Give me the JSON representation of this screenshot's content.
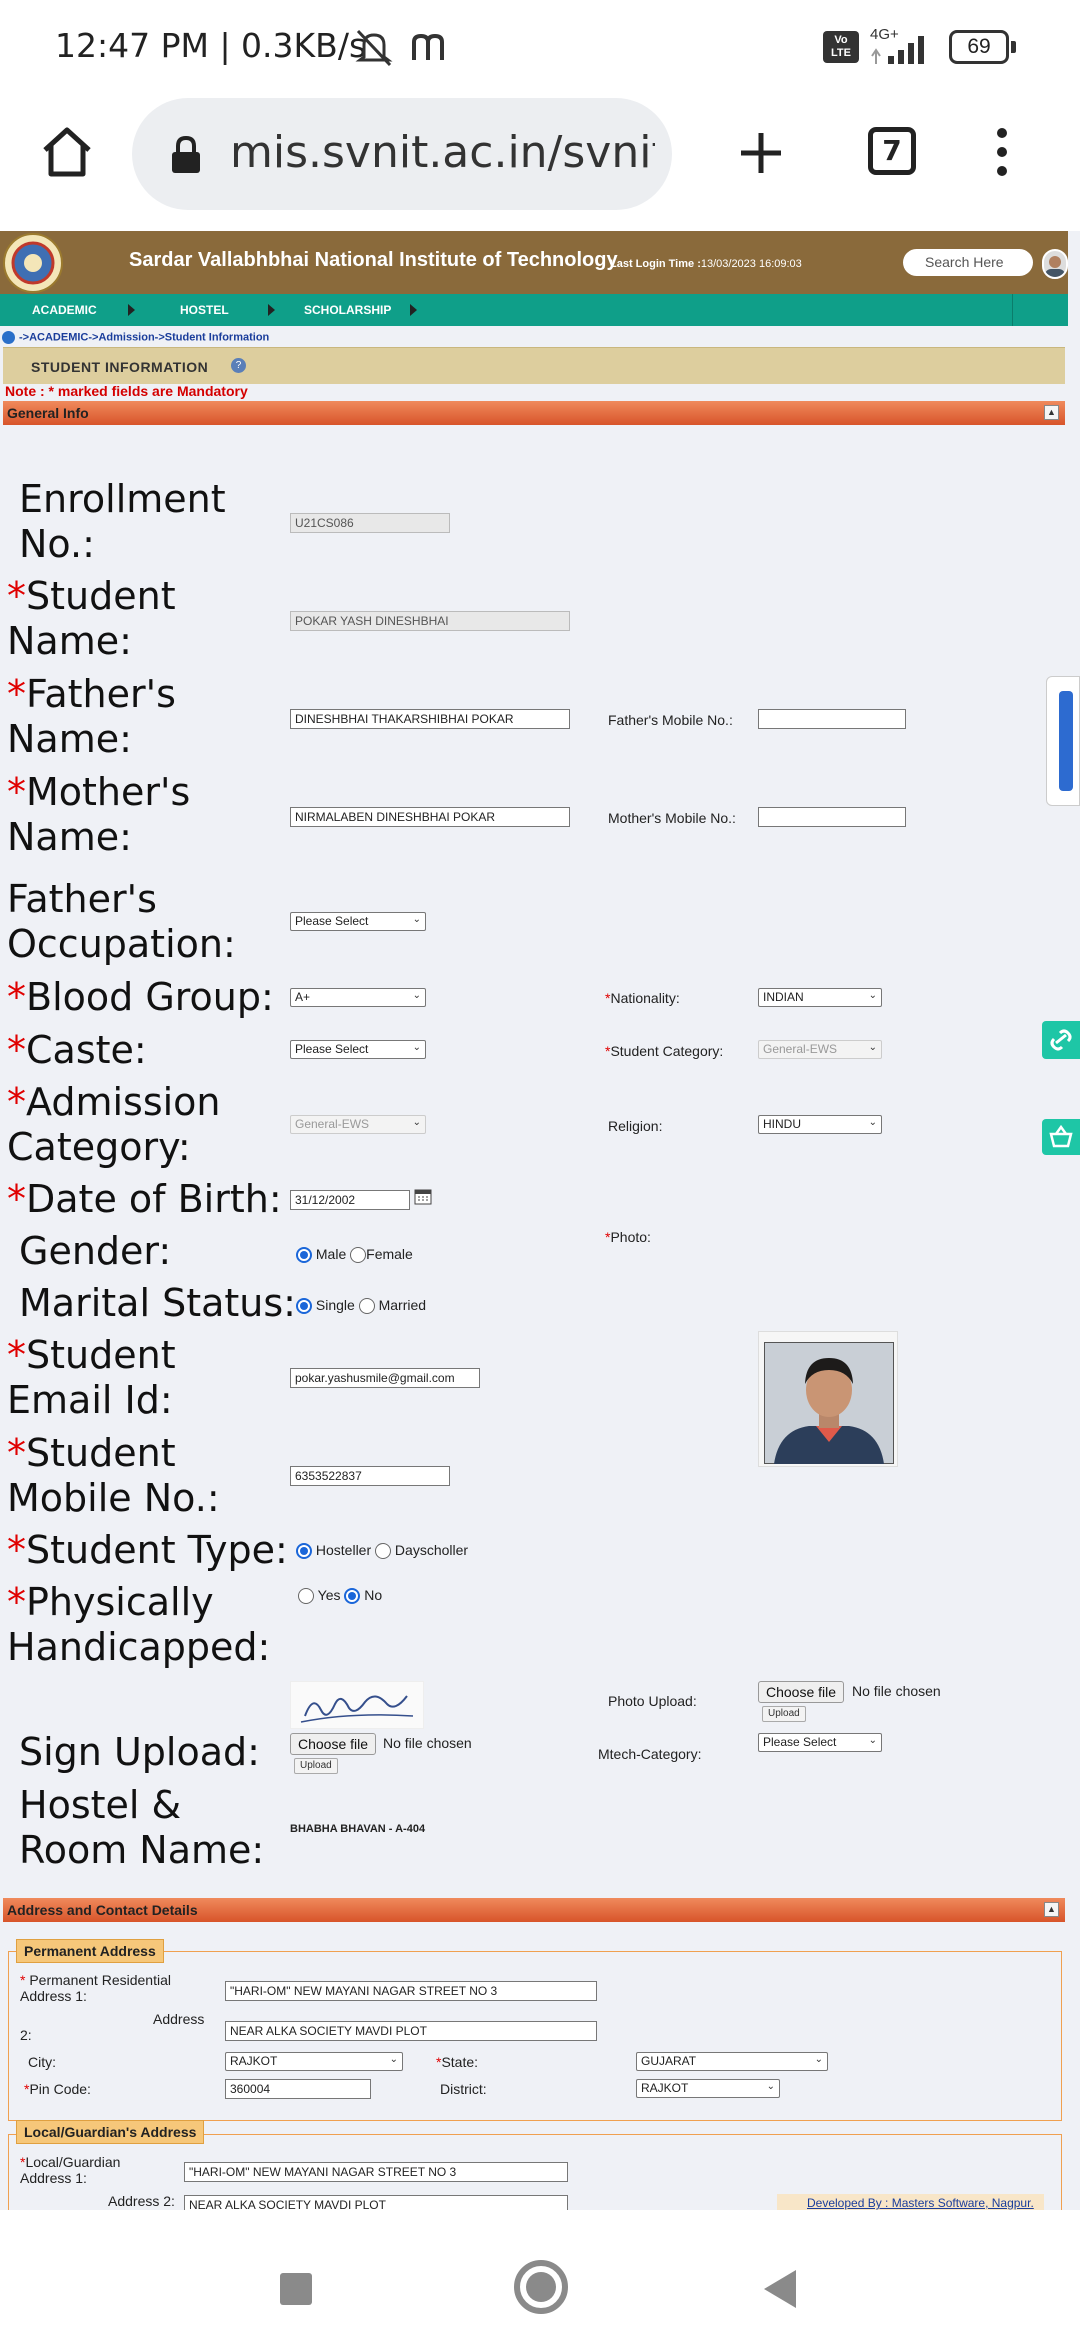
{
  "status_bar": {
    "time": "12:47 PM | 0.3KB/s",
    "battery": "69",
    "network": "4G+",
    "volte": "Vo LTE"
  },
  "browser": {
    "url": "mis.svnit.ac.in/svnit/a",
    "tab_count": "7"
  },
  "header": {
    "institute_name": "Sardar Vallabhbhai National Institute of Technology",
    "last_login_label": "Last Login Time :",
    "last_login_value": "13/03/2023 16:09:03",
    "search_placeholder": "Search Here"
  },
  "menu": {
    "items": [
      "ACADEMIC",
      "HOSTEL",
      "SCHOLARSHIP"
    ]
  },
  "breadcrumb": "->ACADEMIC->Admission->Student Information",
  "page_title": "STUDENT INFORMATION",
  "note": "Note : * marked fields are Mandatory",
  "general_info": {
    "section_title": "General Info",
    "enrollment_label": "Enrollment No.:",
    "enrollment_value": "U21CS086",
    "student_name_label": "Student Name:",
    "student_name_value": "POKAR YASH DINESHBHAI",
    "father_name_label": "Father's Name:",
    "father_name_value": "DINESHBHAI THAKARSHIBHAI POKAR",
    "father_mobile_label": "Father's Mobile No.:",
    "father_mobile_value": "",
    "mother_name_label": "Mother's Name:",
    "mother_name_value": "NIRMALABEN DINESHBHAI POKAR",
    "mother_mobile_label": "Mother's Mobile No.:",
    "mother_mobile_value": "",
    "father_occupation_label": "Father's Occupation:",
    "father_occupation_value": "Please Select",
    "blood_group_label": "Blood Group:",
    "blood_group_value": "A+",
    "nationality_label": "Nationality:",
    "nationality_value": "INDIAN",
    "caste_label": "Caste:",
    "caste_value": "Please Select",
    "student_category_label": "Student Category:",
    "student_category_value": "General-EWS",
    "admission_category_label": "Admission Category:",
    "admission_category_value": "General-EWS",
    "religion_label": "Religion:",
    "religion_value": "HINDU",
    "dob_label": "Date of Birth:",
    "dob_value": "31/12/2002",
    "photo_label": "Photo:",
    "gender_label": "Gender:",
    "gender_options": [
      "Male",
      "Female"
    ],
    "gender_selected": "Male",
    "marital_label": "Marital Status:",
    "marital_options": [
      "Single",
      "Married"
    ],
    "marital_selected": "Single",
    "email_label": "Student Email Id:",
    "email_value": "pokar.yashusmile@gmail.com",
    "mobile_label": "Student Mobile No.:",
    "mobile_value": "6353522837",
    "student_type_label": "Student Type:",
    "student_type_options": [
      "Hosteller",
      "Dayscholler"
    ],
    "student_type_selected": "Hosteller",
    "physically_label": "Physically Handicapped:",
    "physically_options": [
      "Yes",
      "No"
    ],
    "physically_selected": "No",
    "photo_upload_label": "Photo Upload:",
    "choose_file": "Choose file",
    "no_file": "No file chosen",
    "upload": "Upload",
    "sign_upload_label": "Sign Upload:",
    "mtech_category_label": "Mtech-Category:",
    "mtech_category_value": "Please Select",
    "hostel_label": "Hostel & Room Name:",
    "hostel_value": "BHABHA BHAVAN - A-404"
  },
  "address": {
    "section_title": "Address and Contact Details",
    "permanent_legend": "Permanent Address",
    "perm_addr1_label": "Permanent Residential Address 1:",
    "perm_addr1_value": "\"HARI-OM\" NEW MAYANI NAGAR STREET NO 3",
    "perm_addr2_label": "Address 2:",
    "perm_addr2_value": "NEAR ALKA SOCIETY MAVDI PLOT",
    "city_label": "City:",
    "city_value": "RAJKOT",
    "state_label": "State:",
    "state_value": "GUJARAT",
    "pin_label": "Pin Code:",
    "pin_value": "360004",
    "district_label": "District:",
    "district_value": "RAJKOT",
    "local_legend": "Local/Guardian's Address",
    "local_addr1_label": "Local/Guardian Address 1:",
    "local_addr1_value": "\"HARI-OM\" NEW MAYANI NAGAR STREET NO 3",
    "local_addr2_label": "Address 2:",
    "local_addr2_value": "NEAR ALKA SOCIETY MAVDI PLOT"
  },
  "footer_credit": "Developed By : Masters Software, Nagpur."
}
